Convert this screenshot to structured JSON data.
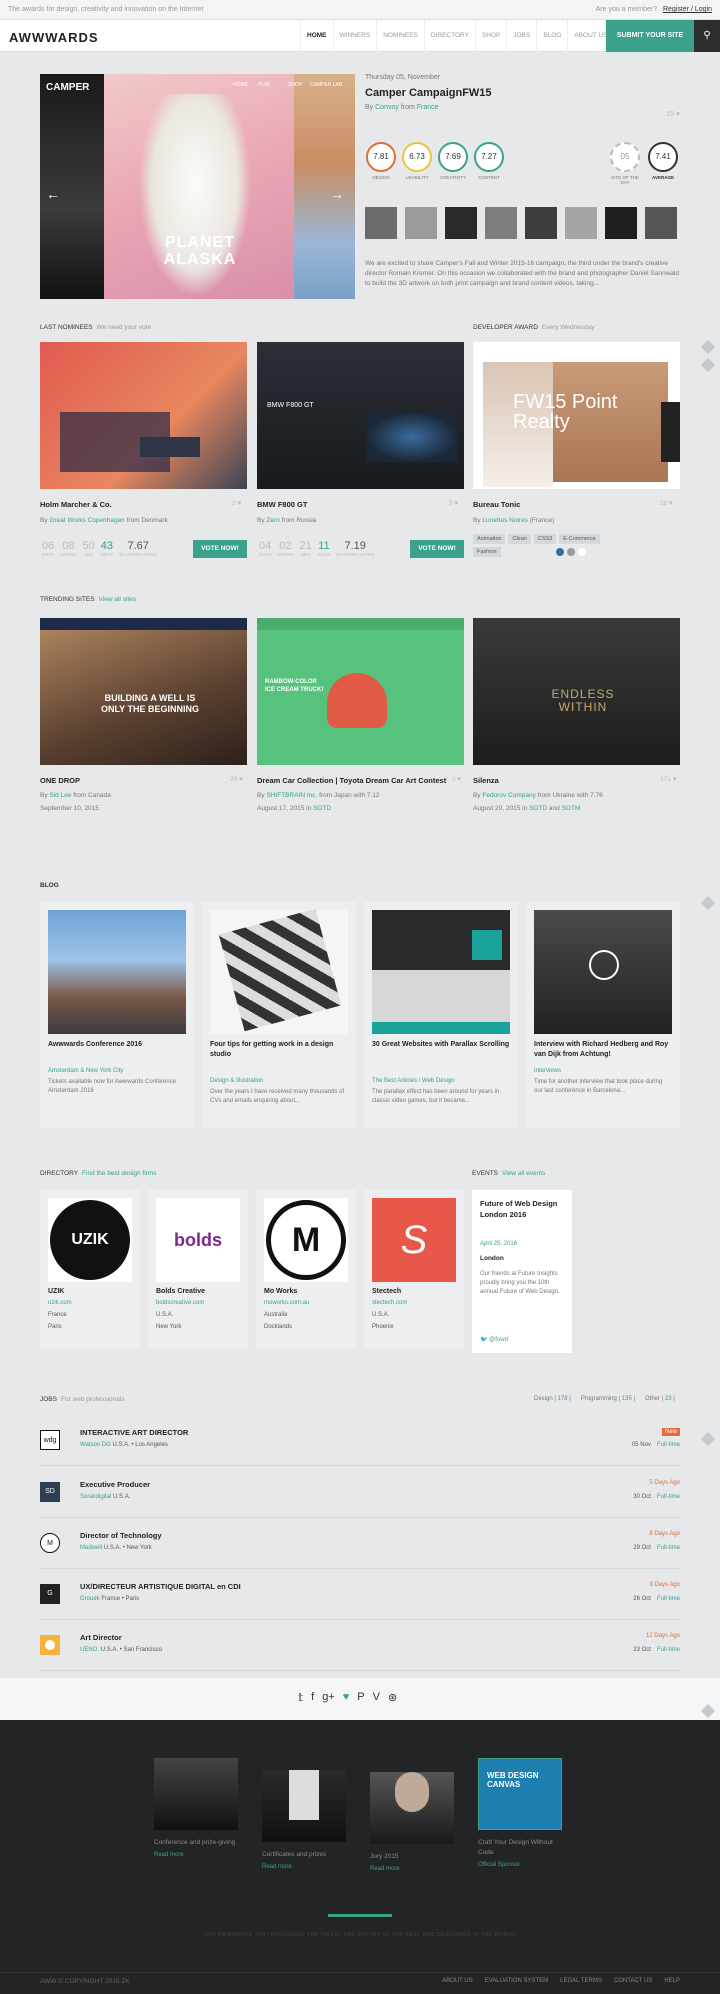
{
  "topbar": {
    "tagline": "The awards for design, creativity and innovation on the Internet",
    "member_q": "Are you a member?",
    "login": "Register / Login"
  },
  "nav": {
    "logo": "AWWWARDS",
    "items": [
      "HOME",
      "WINNERS",
      "NOMINEES",
      "DIRECTORY",
      "SHOP",
      "JOBS",
      "BLOG",
      "ABOUT US"
    ],
    "submit": "SUBMIT YOUR SITE"
  },
  "hero": {
    "brand": "CAMPER",
    "big_text": "PLANET ALASKA",
    "menu": [
      "HOME",
      "PLAY",
      "SHOP",
      "CAMPER LAB"
    ],
    "date": "Thursday 05, November",
    "title": "Camper CampaignFW15",
    "by": "By",
    "author": "Convoy",
    "from": "from",
    "country": "France",
    "likes": "19",
    "scores": [
      {
        "value": "7.81",
        "label": "DESIGN",
        "color": "#e36a3c"
      },
      {
        "value": "6.73",
        "label": "USABILITY",
        "color": "#e8c53a"
      },
      {
        "value": "7.69",
        "label": "CREATIVITY",
        "color": "#3aa28b"
      },
      {
        "value": "7.27",
        "label": "CONTENT",
        "color": "#3aa28b"
      }
    ],
    "sotd": {
      "value": "05",
      "label": "SITE OF THE DAY"
    },
    "average": {
      "value": "7.41",
      "label": "AVERAGE"
    },
    "description": "We are excited to share Camper's Fall and Winter 2015-16 campaign, the third under the brand's creative director Romain Kremer. On this occasion we collaborated with the brand and photographer Daniel Sannwald to build the 3D artwork on both print campaign and brand content videos, taking..."
  },
  "nominees": {
    "title": "LAST NOMINEES",
    "sub": "We need your vote",
    "cards": [
      {
        "title": "Holm Marcher & Co.",
        "by": "By",
        "author": "Great Works Copenhagen",
        "from": "from",
        "country": "Denmark",
        "likes": "3",
        "timer": [
          {
            "n": "06",
            "u": "DAYS"
          },
          {
            "n": "08",
            "u": "HOURS"
          },
          {
            "n": "50",
            "u": "MIN"
          },
          {
            "n": "43",
            "u": "SECS"
          }
        ],
        "score": "7.67",
        "score_label": "26 USERS VOTES",
        "vote": "VOTE NOW!"
      },
      {
        "title": "BMW F800 GT",
        "by": "By",
        "author": "Zero",
        "from": "from",
        "country": "Russia",
        "likes": "5",
        "timer": [
          {
            "n": "04",
            "u": "DAYS"
          },
          {
            "n": "02",
            "u": "HOURS"
          },
          {
            "n": "21",
            "u": "MIN"
          },
          {
            "n": "11",
            "u": "SECS"
          }
        ],
        "score": "7.19",
        "score_label": "48 USERS VOTES",
        "vote": "VOTE NOW!"
      }
    ]
  },
  "developer": {
    "title": "DEVELOPER AWARD",
    "sub": "Every Wednesday",
    "card": {
      "title": "Bureau Tonic",
      "by": "By",
      "author": "Lunettes Noires",
      "country": "(France)",
      "likes": "28",
      "big": "FW15 Point Realty",
      "tags": [
        "Animation",
        "Clean",
        "CSS3",
        "E-Commerce",
        "Fashion"
      ]
    }
  },
  "trending": {
    "title": "TRENDING SITES",
    "sub": "View all sites",
    "cards": [
      {
        "title": "ONE DROP",
        "by": "By",
        "author": "Sid Lee",
        "from": "from",
        "country": "Canada",
        "date": "September 10, 2015",
        "likes": "29",
        "img_text": "BUILDING A WELL IS ONLY THE BEGINNING"
      },
      {
        "title": "Dream Car Collection | Toyota Dream Car Art Contest",
        "by": "By",
        "author": "SHIFTBRAIN Inc.",
        "from": "from",
        "country": "Japan",
        "with": "with",
        "score": "7.12",
        "date": "August 17, 2015",
        "in": "in",
        "badge": "SOTD",
        "likes": "2",
        "img_text": "RAMBOW-COLOR ICE CREAM TRUCK!"
      },
      {
        "title": "Silenza",
        "by": "By",
        "author": "Fedorov Company",
        "from": "from",
        "country": "Ukraine",
        "with": "with",
        "score": "7.76",
        "date": "August 20, 2015",
        "in": "in",
        "badge": "SOTD",
        "and": "and",
        "badge2": "SOTM",
        "likes": "171",
        "img_text": "ENDLESS WITHIN"
      }
    ]
  },
  "blog": {
    "title": "BLOG",
    "cards": [
      {
        "title": "Awwwards Conference 2016",
        "cat": "Amsterdam & New York City",
        "desc": "Tickets available now for Awwwards Conference Amsterdam 2016"
      },
      {
        "title": "Four tips for getting work in a design studio",
        "cat": "Design & Illustration",
        "desc": "Over the years I have received many thousands of CVs and emails enquiring about..."
      },
      {
        "title": "30 Great Websites with Parallax Scrolling",
        "cat": "The Best Articles / Web Design",
        "desc": "The parallax effect has been around for years in classic video games, but it became..."
      },
      {
        "title": "Interview with Richard Hedberg and Roy van Dijk from Achtung!",
        "cat": "Interviews",
        "desc": "Time for another interview that took place during our last conference in Barcelona..."
      }
    ]
  },
  "directory": {
    "title": "DIRECTORY",
    "sub": "Find the best design firms",
    "cards": [
      {
        "name": "UZIK",
        "url": "uzik.com",
        "country": "France",
        "city": "Paris",
        "logo": "UZIK"
      },
      {
        "name": "Bolds Creative",
        "url": "boldscreative.com",
        "country": "U.S.A.",
        "city": "New York",
        "logo": "bolds"
      },
      {
        "name": "Mo Works",
        "url": "moworks.com.au",
        "country": "Australia",
        "city": "Docklands",
        "logo": "M"
      },
      {
        "name": "Stectech",
        "url": "stectech.com",
        "country": "U.S.A.",
        "city": "Phoenix",
        "logo": "S"
      }
    ]
  },
  "events": {
    "title": "EVENTS",
    "sub": "View all events",
    "card": {
      "title": "Future of Web Design London 2016",
      "date": "April 25, 2016",
      "city": "London",
      "desc": "Our friends at Future Insights proudly bring you the 10th annual Future of Web Design.",
      "handle": "@fowd"
    }
  },
  "jobs": {
    "title": "JOBS",
    "sub": "For web professionals",
    "filters": [
      {
        "label": "Design",
        "count": "178"
      },
      {
        "label": "Programming",
        "count": "135"
      },
      {
        "label": "Other",
        "count": "23"
      }
    ],
    "items": [
      {
        "logo": "wdg",
        "title": "INTERACTIVE ART DIRECTOR",
        "company": "Watson DG",
        "loc": "U.S.A. • Los Angeles",
        "ago": "New",
        "date": "05 Nov",
        "type": "Full-time"
      },
      {
        "logo": "SD",
        "title": "Executive Producer",
        "company": "Sorakdigital",
        "loc": "U.S.A.",
        "ago": "5 Days Ago",
        "date": "30 Oct",
        "type": "Full-time"
      },
      {
        "logo": "M",
        "title": "Director of Technology",
        "company": "Madwell",
        "loc": "U.S.A. • New York",
        "ago": "8 Days Ago",
        "date": "29 Oct",
        "type": "Full-time"
      },
      {
        "logo": "G",
        "title": "UX/DIRECTEUR ARTISTIQUE DIGITAL en CDI",
        "company": "Grouek",
        "loc": "France • Paris",
        "ago": "9 Days Ago",
        "date": "26 Oct",
        "type": "Full-time"
      },
      {
        "logo": "",
        "title": "Art Director",
        "company": "UENO.",
        "loc": "U.S.A. • San Francisco",
        "ago": "12 Days Ago",
        "date": "23 Oct",
        "type": "Full-time"
      }
    ]
  },
  "footer": {
    "cards": [
      {
        "text": "Conference and prize-giving",
        "link": "Read more"
      },
      {
        "text": "Certificates and prizes",
        "link": "Read more"
      },
      {
        "text": "Jury 2015",
        "link": "Read more"
      },
      {
        "text": "Craft Your Design Without Code",
        "link": "Official Sponsor",
        "img_text": "WEB DESIGN CANVAS"
      }
    ],
    "tagline": "THE AWWWARDS THAT RECOGNIZE THE TALENT AND EFFORT OF THE BEST WEB DESIGNERS IN THE WORLD",
    "copyright": "AWW © COPYRIGHT 2015 ZK",
    "links": [
      "ABOUT US",
      "EVALUATION SYSTEM",
      "LEGAL TERMS",
      "CONTACT US",
      "HELP"
    ]
  },
  "colors": {
    "accent": "#3aa28b",
    "orange": "#e36a3c",
    "yellow": "#e8c53a"
  }
}
